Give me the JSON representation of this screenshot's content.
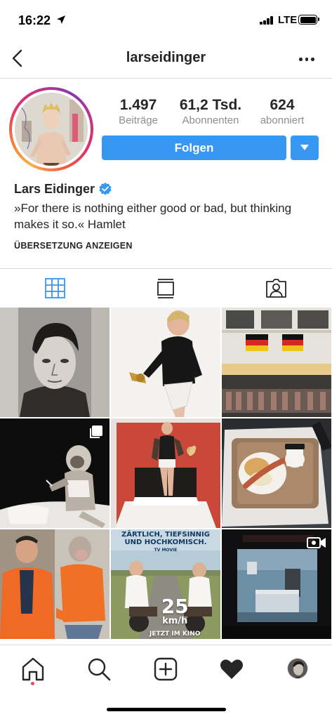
{
  "status_bar": {
    "time": "16:22",
    "network": "LTE",
    "icons": [
      "location-arrow-icon",
      "signal-icon",
      "battery-icon"
    ]
  },
  "header": {
    "title": "larseidinger",
    "icons": [
      "back-chevron-icon",
      "more-options-icon"
    ]
  },
  "profile": {
    "name": "Lars Eidinger",
    "verified": true,
    "bio": "»For there is nothing either good or bad, but thinking makes it so.« Hamlet",
    "translate_label": "ÜBERSETZUNG ANZEIGEN",
    "stats": [
      {
        "value": "1.497",
        "label": "Beiträge"
      },
      {
        "value": "61,2 Tsd.",
        "label": "Abonnenten"
      },
      {
        "value": "624",
        "label": "abonniert"
      }
    ],
    "follow_label": "Folgen"
  },
  "tabs": [
    {
      "icon": "grid-icon",
      "active": true
    },
    {
      "icon": "feed-list-icon",
      "active": false
    },
    {
      "icon": "tagged-person-icon",
      "active": false
    }
  ],
  "grid": {
    "posts": [
      {
        "subject": "portrait-drawing",
        "type": "photo"
      },
      {
        "subject": "man-in-black-turtleneck",
        "type": "photo"
      },
      {
        "subject": "building-with-flags",
        "type": "photo"
      },
      {
        "subject": "monkey-dressed-on-chair",
        "type": "multiple"
      },
      {
        "subject": "man-on-hotel-bed",
        "type": "photo"
      },
      {
        "subject": "breakfast-tray",
        "type": "photo"
      },
      {
        "subject": "man-and-baboon-in-orange",
        "type": "photo"
      },
      {
        "subject": "movie-poster",
        "type": "photo",
        "headline_1": "ZÄRTLICH, TIEFSINNIG",
        "headline_2": "UND HOCHKOMISCH.",
        "source": "TV MOVIE",
        "speed": "25",
        "unit": "km/h",
        "release": "JETZT IM KINO"
      },
      {
        "subject": "hospital-room",
        "type": "video"
      }
    ]
  },
  "bottom_nav": {
    "items": [
      "home-icon",
      "search-icon",
      "add-post-icon",
      "activity-heart-icon",
      "profile-avatar-icon"
    ],
    "home_notification": true
  },
  "colors": {
    "accent": "#3897f0",
    "text": "#262626",
    "secondary_text": "#8e8e8e",
    "divider": "#dbdbdb",
    "notification": "#ed4956"
  }
}
